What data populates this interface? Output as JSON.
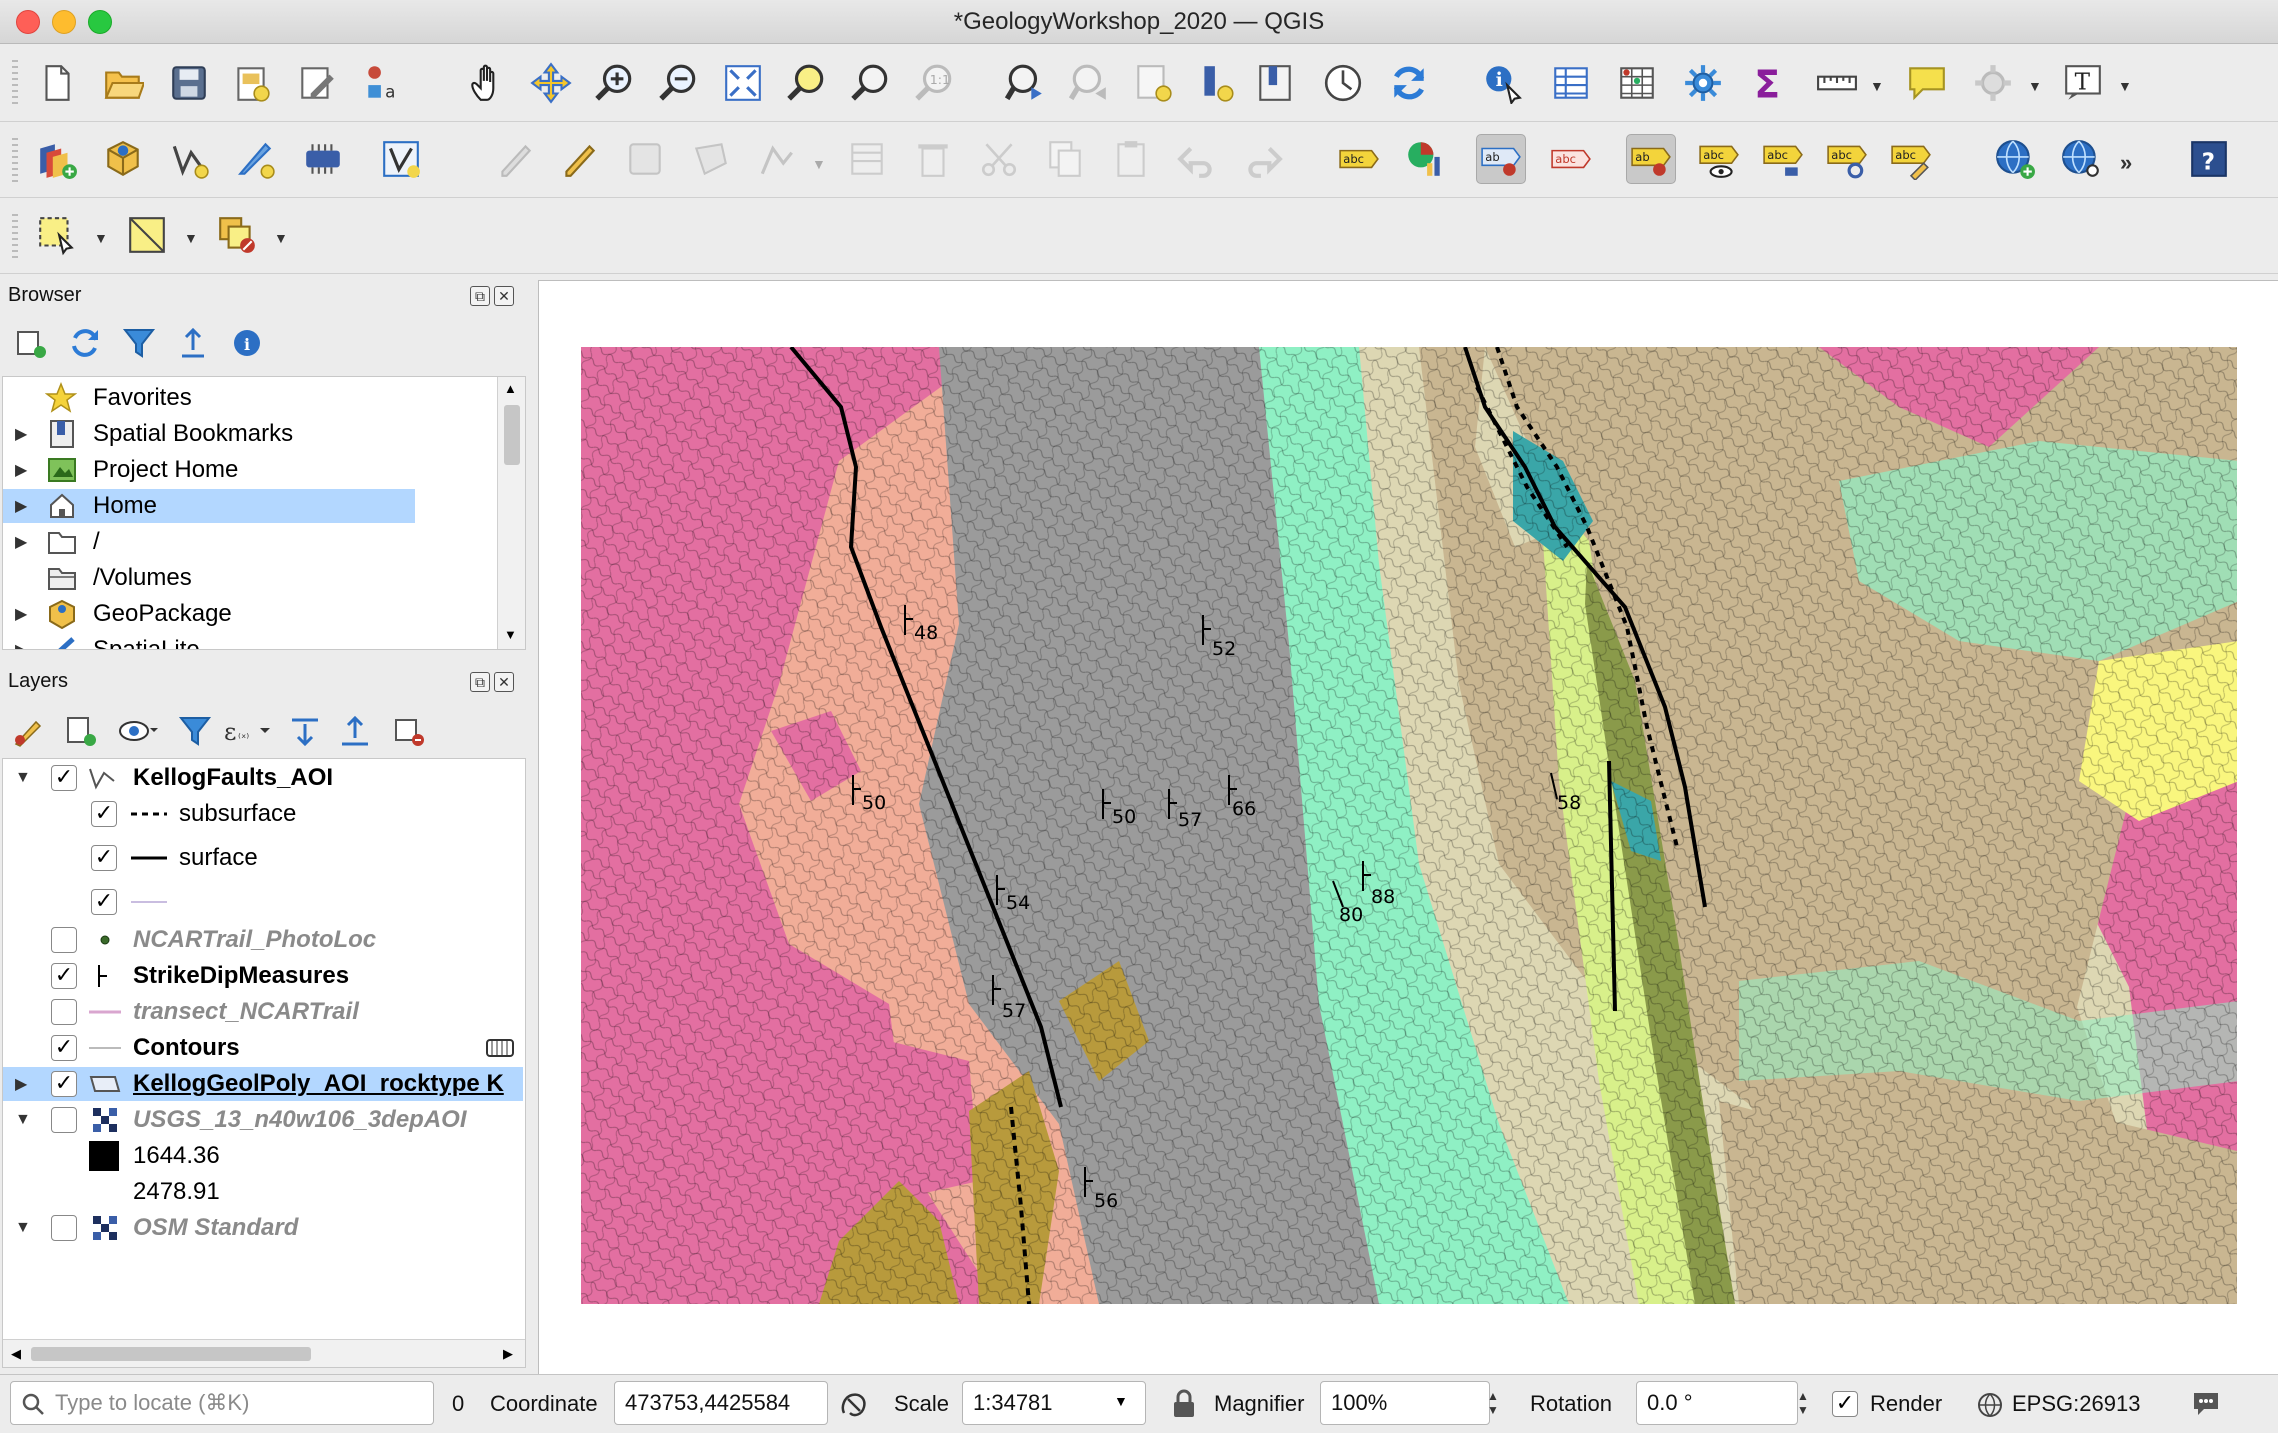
{
  "window": {
    "title": "*GeologyWorkshop_2020 — QGIS"
  },
  "toolbar_icons": {
    "row1": [
      "new-project-icon",
      "open-project-icon",
      "save-project-icon",
      "new-print-layout-icon",
      "style-manager-icon",
      "identify-style-icon",
      "pan-icon",
      "pan-to-selection-icon",
      "zoom-in-icon",
      "zoom-out-icon",
      "zoom-full-icon",
      "zoom-to-selection-icon",
      "zoom-to-layer-icon",
      "zoom-native-icon",
      "zoom-last-icon",
      "zoom-next-icon",
      "new-bookmark-icon",
      "show-bookmarks-icon",
      "new-map-view-icon",
      "temporal-controller-icon",
      "refresh-icon",
      "identify-features-icon",
      "attribute-table-icon",
      "statistical-summary-icon",
      "settings-icon",
      "sum-icon",
      "measure-icon",
      "map-tips-icon",
      "processing-icon",
      "text-annotation-icon"
    ],
    "row2": [
      "data-source-manager-icon",
      "new-geopackage-icon",
      "new-shapefile-icon",
      "digitize-icon",
      "virtual-layer-icon",
      "vertex-tool-icon",
      "toggle-editing-icon",
      "edit-pencil-icon",
      "save-edits-icon",
      "add-polygon-icon",
      "node-tool-icon",
      "modify-attributes-icon",
      "delete-selected-icon",
      "cut-features-icon",
      "copy-features-icon",
      "paste-features-icon",
      "undo-icon",
      "redo-icon",
      "label-toolbar-icon",
      "diagram-icon",
      "pin-labels-icon",
      "highlight-labels-icon",
      "show-hide-labels-icon",
      "move-label-icon",
      "rotate-label-icon",
      "change-label-icon",
      "preview-label-icon",
      "globe-add-icon",
      "globe-search-icon",
      "help-icon"
    ],
    "row3": [
      "select-features-icon",
      "select-by-expression-icon",
      "deselect-features-icon"
    ]
  },
  "browser": {
    "title": "Browser",
    "items": [
      {
        "label": "Favorites",
        "icon": "star-icon"
      },
      {
        "label": "Spatial Bookmarks",
        "icon": "bookmark-icon"
      },
      {
        "label": "Project Home",
        "icon": "project-home-icon"
      },
      {
        "label": "Home",
        "icon": "home-icon"
      },
      {
        "label": "/",
        "icon": "folder-icon"
      },
      {
        "label": "/Volumes",
        "icon": "volumes-icon"
      },
      {
        "label": "GeoPackage",
        "icon": "geopackage-icon"
      },
      {
        "label": "SpatiaLite",
        "icon": "spatialite-icon"
      }
    ]
  },
  "layers": {
    "title": "Layers",
    "items": [
      {
        "label": "KellogFaults_AOI",
        "checked": true,
        "style": "bold"
      },
      {
        "label": "subsurface",
        "checked": true,
        "style": "normal"
      },
      {
        "label": "surface",
        "checked": true,
        "style": "normal"
      },
      {
        "label": "",
        "checked": true,
        "style": "normal"
      },
      {
        "label": "NCARTrail_PhotoLoc",
        "checked": false,
        "style": "italic"
      },
      {
        "label": "StrikeDipMeasures",
        "checked": true,
        "style": "bold"
      },
      {
        "label": "transect_NCARTrail",
        "checked": false,
        "style": "italic"
      },
      {
        "label": "Contours",
        "checked": true,
        "style": "bold"
      },
      {
        "label": "KellogGeolPoly_AOI_rocktype K",
        "checked": true,
        "style": "bold"
      },
      {
        "label": "USGS_13_n40w106_3depAOI",
        "checked": false,
        "style": "italic"
      },
      {
        "label": "1644.36",
        "checked": null,
        "style": "normal"
      },
      {
        "label": "2478.91",
        "checked": null,
        "style": "normal"
      },
      {
        "label": "OSM Standard",
        "checked": false,
        "style": "italic"
      }
    ]
  },
  "map": {
    "dip_labels": [
      "48",
      "50",
      "54",
      "50",
      "57",
      "52",
      "66",
      "58",
      "80",
      "88",
      "57",
      "56"
    ],
    "colors": {
      "pink": "#e36fa1",
      "salmon": "#f1ad98",
      "gray": "#9b9b9b",
      "aqua": "#8ff0c4",
      "tan": "#c9b691",
      "khaki": "#ddd7b3",
      "olive": "#8a9a4a",
      "teal": "#3aa6a8",
      "yellow": "#f9f67e",
      "lime": "#d8f08a",
      "ochre": "#b89a3c"
    }
  },
  "status": {
    "locator_placeholder": "Type to locate (⌘K)",
    "message_count": "0",
    "coordinate_label": "Coordinate",
    "coordinate_value": "473753,4425584",
    "scale_label": "Scale",
    "scale_value": "1:34781",
    "magnifier_label": "Magnifier",
    "magnifier_value": "100%",
    "rotation_label": "Rotation",
    "rotation_value": "0.0 °",
    "render_label": "Render",
    "render_checked": true,
    "crs": "EPSG:26913"
  }
}
